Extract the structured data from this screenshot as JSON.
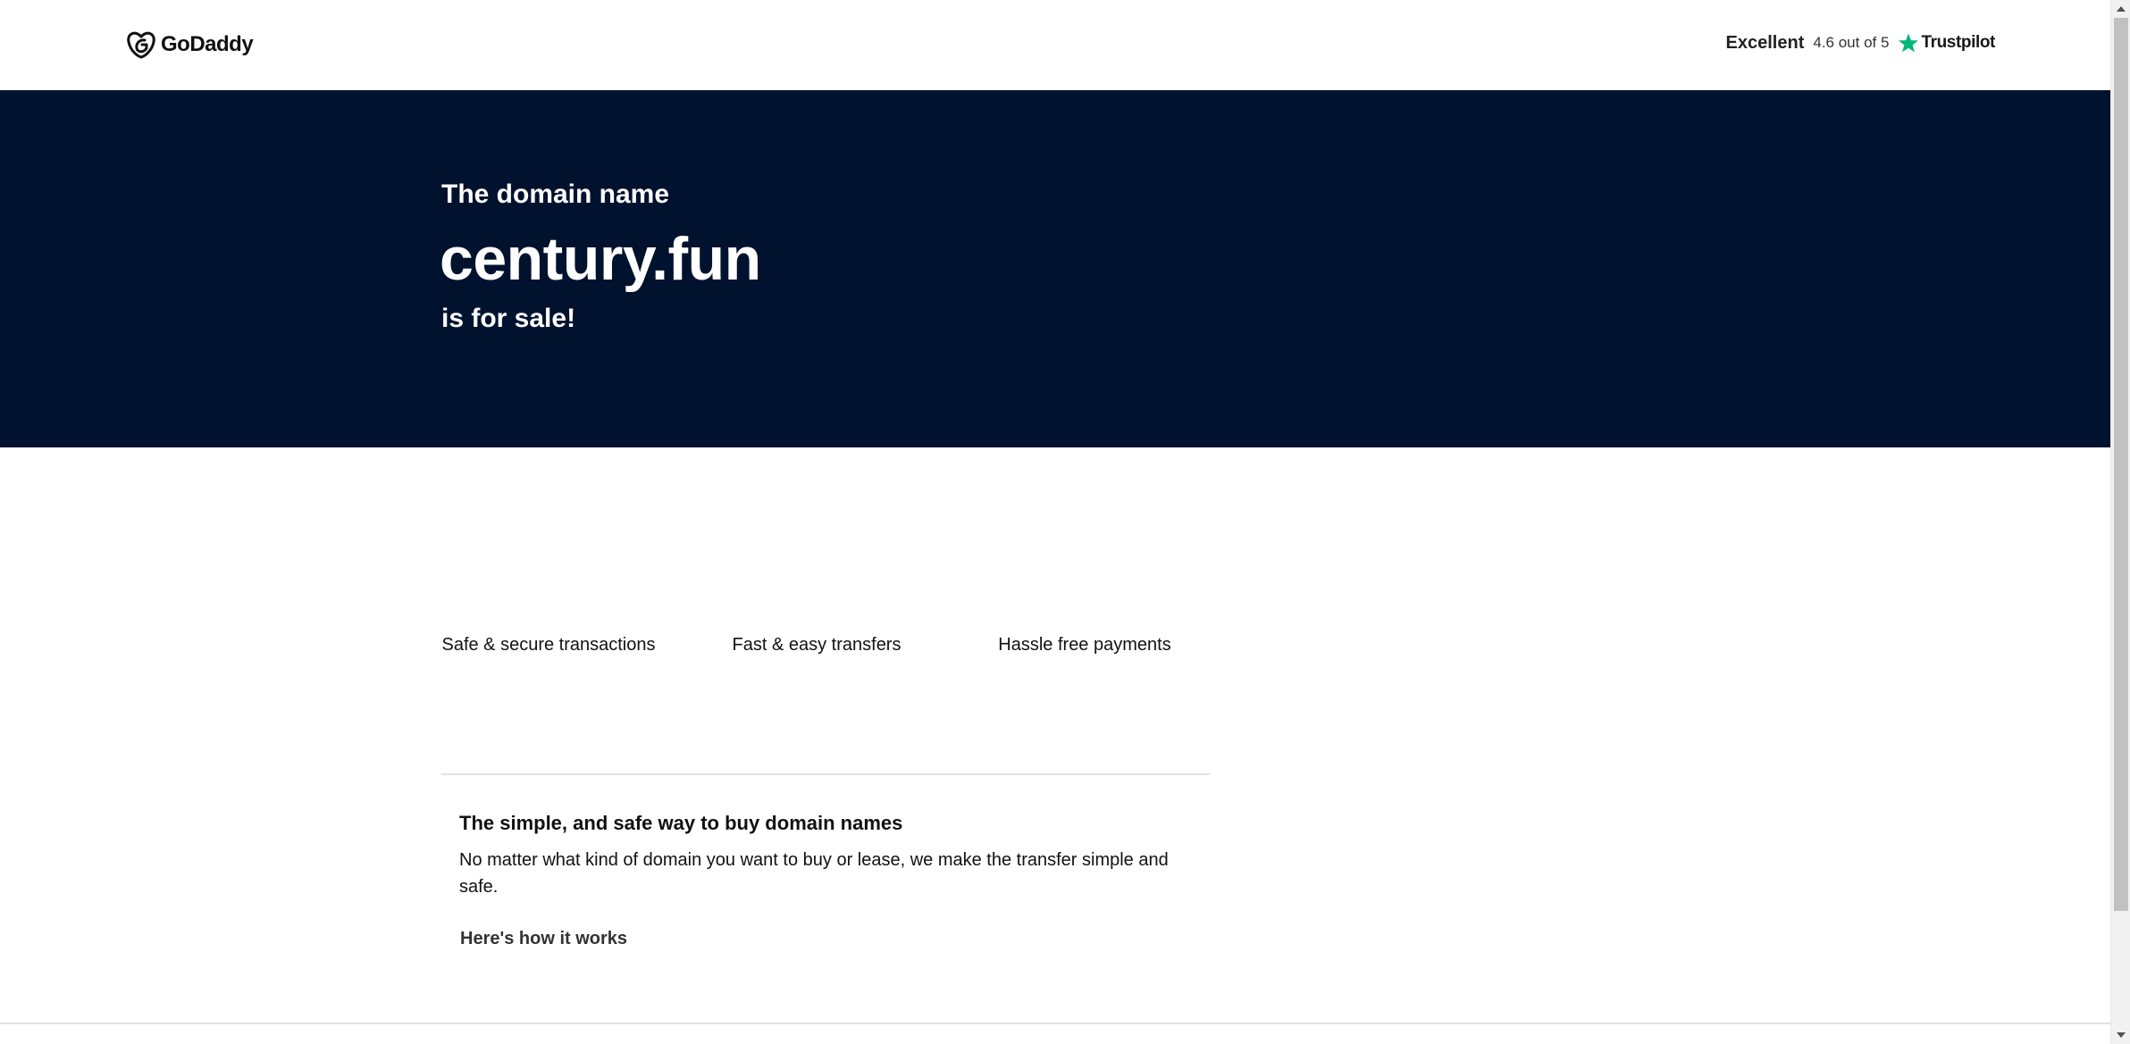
{
  "header": {
    "logo_text": "GoDaddy",
    "trustpilot": {
      "rating_word": "Excellent",
      "score_text": "4.6 out of 5",
      "brand": "Trustpilot",
      "star_color": "#00b67a"
    }
  },
  "hero": {
    "kicker": "The domain name",
    "domain": "century.fun",
    "sale_text": "is for sale!",
    "background": "#00122e"
  },
  "features": [
    {
      "label": "Safe & secure transactions"
    },
    {
      "label": "Fast & easy transfers"
    },
    {
      "label": "Hassle free payments"
    }
  ],
  "info": {
    "title": "The simple, and safe way to buy domain names",
    "body": "No matter what kind of domain you want to buy or lease, we make the transfer simple and safe.",
    "link": "Here's how it works"
  },
  "icons": {
    "logo": "godaddy-logo-icon",
    "star": "star-icon",
    "scroll_up": "arrow-up-icon",
    "scroll_down": "arrow-down-icon"
  }
}
